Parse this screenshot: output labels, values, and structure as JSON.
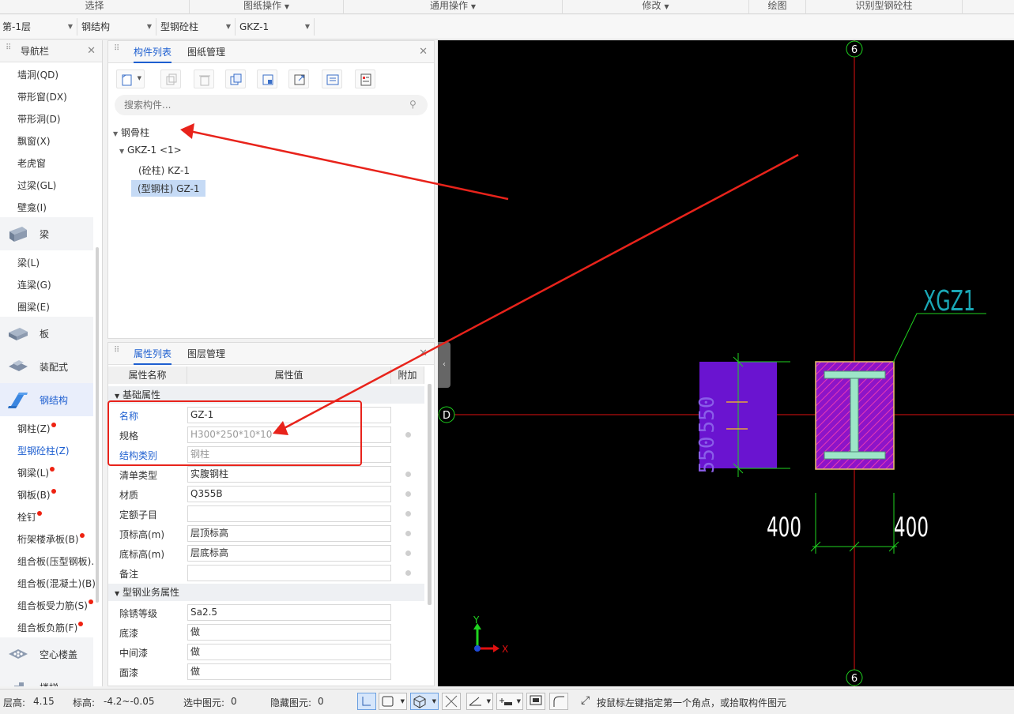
{
  "ribbon": {
    "groups": [
      "选择",
      "图纸操作",
      "通用操作",
      "修改",
      "绘图",
      "识别型钢砼柱"
    ]
  },
  "toolbar": {
    "floor": "第-1层",
    "category": "钢结构",
    "type": "型钢砼柱",
    "component": "GKZ-1"
  },
  "nav": {
    "title": "导航栏",
    "items_top": [
      "墙洞(QD)",
      "带形窗(DX)",
      "带形洞(D)",
      "飘窗(X)",
      "老虎窗",
      "过梁(GL)",
      "壁龛(I)"
    ],
    "cat_beam": "梁",
    "items_beam": [
      "梁(L)",
      "连梁(G)",
      "圈梁(E)"
    ],
    "cat_slab": "板",
    "cat_prefab": "装配式",
    "cat_steel": "钢结构",
    "items_steel": [
      "钢柱(Z)",
      "型钢砼柱(Z)",
      "钢梁(L)",
      "钢板(B)",
      "栓钉",
      "桁架楼承板(B)",
      "组合板(压型钢板).",
      "组合板(混凝土)(B)",
      "组合板受力筋(S)",
      "组合板负筋(F)"
    ],
    "cat_hollow": "空心楼盖",
    "cat_stair": "楼梯"
  },
  "component_panel": {
    "tabs": [
      "构件列表",
      "图纸管理"
    ],
    "search_placeholder": "搜索构件...",
    "tree": {
      "root": "钢骨柱",
      "child": "GKZ-1 <1>",
      "leaf1": "(砼柱) KZ-1",
      "leaf2": "(型钢柱) GZ-1"
    }
  },
  "property_panel": {
    "tabs": [
      "属性列表",
      "图层管理"
    ],
    "columns": [
      "属性名称",
      "属性值",
      "附加"
    ],
    "group1": "基础属性",
    "rows1": [
      {
        "name": "名称",
        "value": "GZ-1"
      },
      {
        "name": "规格",
        "value": "H300*250*10*10"
      },
      {
        "name": "结构类别",
        "value": "钢柱"
      },
      {
        "name": "清单类型",
        "value": "实腹钢柱"
      },
      {
        "name": "材质",
        "value": "Q355B"
      },
      {
        "name": "定额子目",
        "value": ""
      },
      {
        "name": "顶标高(m)",
        "value": "层顶标高"
      },
      {
        "name": "底标高(m)",
        "value": "层底标高"
      },
      {
        "name": "备注",
        "value": ""
      }
    ],
    "group2": "型钢业务属性",
    "rows2": [
      {
        "name": "除锈等级",
        "value": "Sa2.5"
      },
      {
        "name": "底漆",
        "value": "做"
      },
      {
        "name": "中间漆",
        "value": "做"
      },
      {
        "name": "面漆",
        "value": "做"
      }
    ]
  },
  "canvas": {
    "axis_top": "6",
    "axis_bottom": "6",
    "axis_left": "D",
    "label_xgz": "XGZ1",
    "dim_left": "400",
    "dim_right": "400",
    "dim_vert1": "550",
    "dim_vert2": "550",
    "ucs_y": "Y",
    "ucs_x": "X"
  },
  "status": {
    "floor_height_label": "层高:",
    "floor_height": "4.15",
    "elev_label": "标高:",
    "elev": "-4.2~-0.05",
    "selected_label": "选中图元:",
    "selected": "0",
    "hidden_label": "隐藏图元:",
    "hidden": "0",
    "hint": "按鼠标左键指定第一个角点，或拾取构件图元"
  },
  "colors": {
    "accent": "#1e5fd0",
    "annotation_red": "#e8231b",
    "axis_red": "#e01010",
    "column_purple": "#7a1fd6",
    "column_magenta": "#b52ad0",
    "steel_section": "#9de6c8",
    "dimension_green": "#1fd31f",
    "label_cyan": "#1aa7b5"
  }
}
